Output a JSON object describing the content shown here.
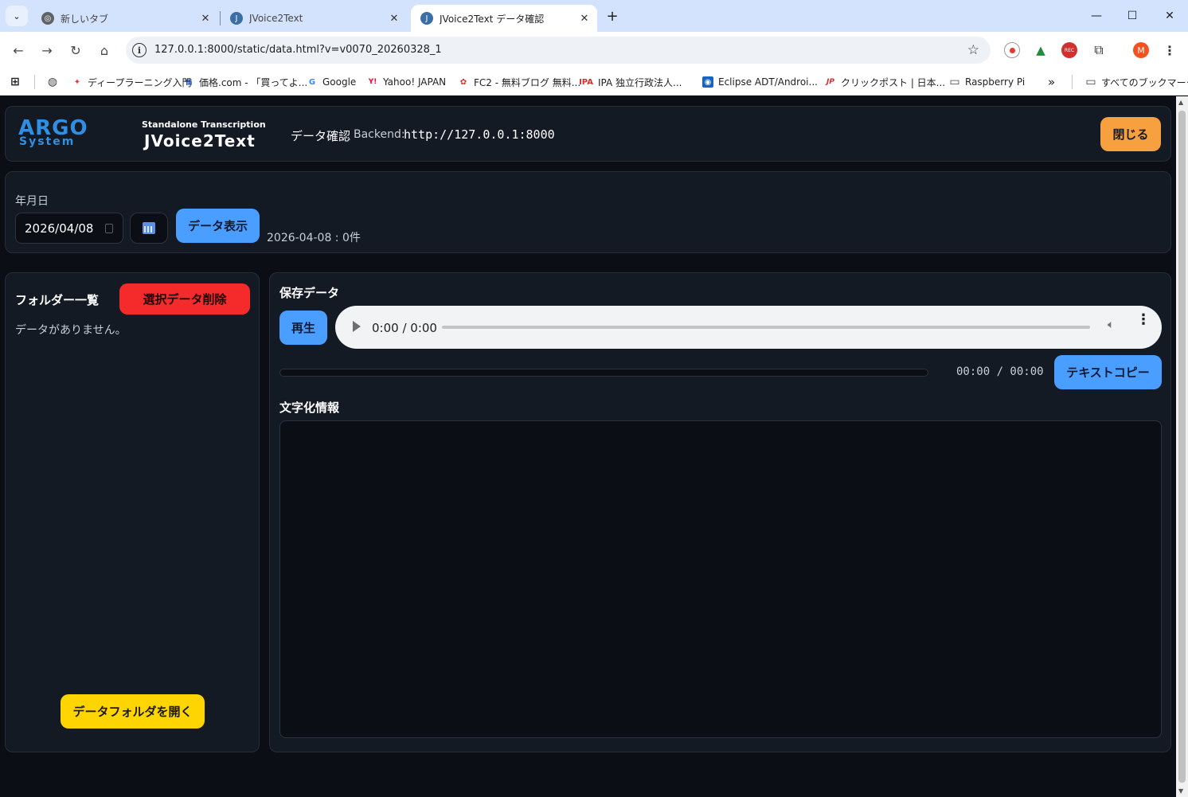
{
  "browser": {
    "tabs": [
      {
        "title": "新しいタブ",
        "close": "✕"
      },
      {
        "title": "JVoice2Text",
        "close": "✕"
      },
      {
        "title": "JVoice2Text データ確認",
        "close": "✕"
      }
    ],
    "new_tab": "+",
    "window": {
      "minimize": "—",
      "maximize": "☐",
      "close": "✕"
    },
    "url": "127.0.0.1:8000/static/data.html?v=v0070_20260328_1",
    "profile_initial": "M",
    "bookmarks": [
      {
        "label": "ディープラーニング入門",
        "icon": "✦"
      },
      {
        "label": "価格.com - 「買ってよ...",
        "icon": "価"
      },
      {
        "label": "Google",
        "icon": "G"
      },
      {
        "label": "Yahoo! JAPAN",
        "icon": "Y!"
      },
      {
        "label": "FC2 - 無料ブログ 無料...",
        "icon": "✿"
      },
      {
        "label": "IPA 独立行政法人...",
        "icon": "IPA"
      },
      {
        "label": "Eclipse ADT/Androi...",
        "icon": "◉"
      },
      {
        "label": "クリックポスト | 日本...",
        "icon": "JP"
      },
      {
        "label": "Raspberry Pi",
        "icon": "▭"
      }
    ],
    "more_bookmarks": "»",
    "all_bookmarks": "すべてのブックマーク"
  },
  "header": {
    "logo_top": "ARGO",
    "logo_bottom": "System",
    "app_subtitle": "Standalone Transcription",
    "app_name": "JVoice2Text",
    "page_label": "データ確認",
    "backend_label": "Backend:",
    "backend_url": "http://127.0.0.1:8000",
    "close_label": "閉じる"
  },
  "filter": {
    "date_label": "年月日",
    "date_value": "2026/04/08",
    "show_label": "データ表示",
    "result_text": "2026-04-08 : 0件"
  },
  "folders": {
    "title": "フォルダー一覧",
    "delete_label": "選択データ削除",
    "empty_text": "データがありません。",
    "open_label": "データフォルダを開く"
  },
  "saved": {
    "title": "保存データ",
    "play_label": "再生",
    "audio_time": "0:00 / 0:00",
    "progress_fraction": 0,
    "time_readout": "00:00 / 00:00",
    "copy_label": "テキストコピー"
  },
  "transcription": {
    "title": "文字化情報",
    "text": ""
  }
}
